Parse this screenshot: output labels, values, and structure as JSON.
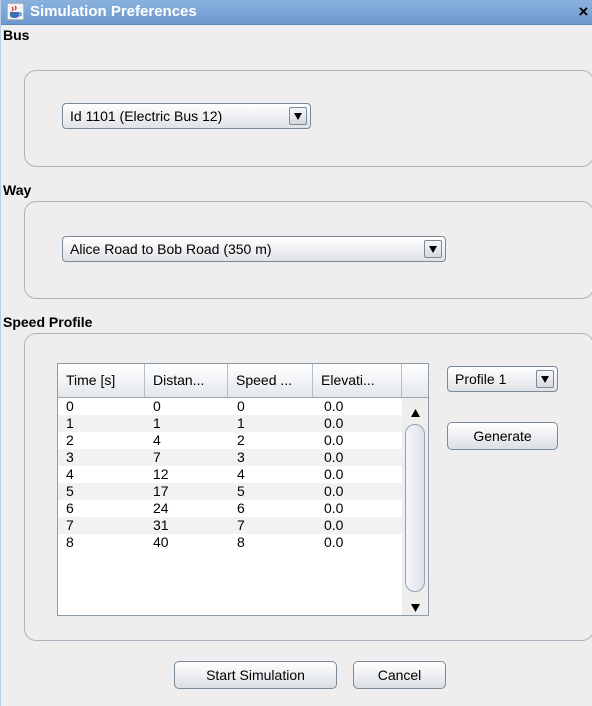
{
  "window": {
    "title": "Simulation Preferences",
    "close_label": "×"
  },
  "bus_section": {
    "label": "Bus",
    "selected": "Id 1101 (Electric Bus 12)"
  },
  "way_section": {
    "label": "Way",
    "selected": "Alice Road to Bob Road (350 m)"
  },
  "speed_section": {
    "label": "Speed Profile",
    "profile_selected": "Profile 1",
    "generate_label": "Generate",
    "columns": [
      "Time [s]",
      "Distan...",
      "Speed ...",
      "Elevati..."
    ],
    "rows": [
      [
        "0",
        "0",
        "0",
        "0.0"
      ],
      [
        "1",
        "1",
        "1",
        "0.0"
      ],
      [
        "2",
        "4",
        "2",
        "0.0"
      ],
      [
        "3",
        "7",
        "3",
        "0.0"
      ],
      [
        "4",
        "12",
        "4",
        "0.0"
      ],
      [
        "5",
        "17",
        "5",
        "0.0"
      ],
      [
        "6",
        "24",
        "6",
        "0.0"
      ],
      [
        "7",
        "31",
        "7",
        "0.0"
      ],
      [
        "8",
        "40",
        "8",
        "0.0"
      ]
    ]
  },
  "footer": {
    "start_label": "Start Simulation",
    "cancel_label": "Cancel"
  },
  "colors": {
    "titlebar": "#7aa5d8",
    "panel": "#eeeeee",
    "border": "#aab5c2"
  },
  "icons": {
    "app": "java-cup-icon",
    "dropdown": "triangle-down-icon",
    "scroll_up": "triangle-up-icon",
    "scroll_down": "triangle-down-icon"
  }
}
